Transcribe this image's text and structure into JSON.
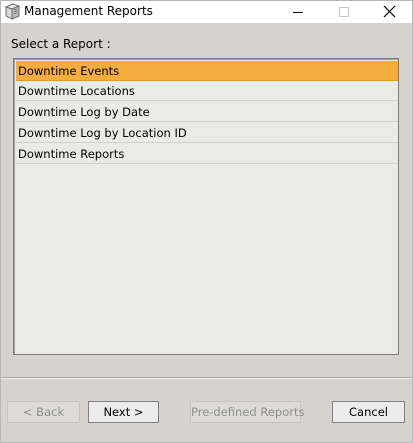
{
  "window": {
    "title": "Management Reports"
  },
  "prompt_label": "Select a Report :",
  "reports": [
    {
      "label": "Downtime Events",
      "selected": true
    },
    {
      "label": "Downtime Locations",
      "selected": false
    },
    {
      "label": "Downtime Log by Date",
      "selected": false
    },
    {
      "label": "Downtime Log by Location ID",
      "selected": false
    },
    {
      "label": "Downtime Reports",
      "selected": false
    }
  ],
  "buttons": {
    "back": "< Back",
    "next": "Next >",
    "predefined": "Pre-defined Reports",
    "cancel": "Cancel"
  },
  "colors": {
    "selection": "#f4ad3f",
    "list_background": "#ebebe6",
    "window_background": "#d6d3ce"
  },
  "icons": {
    "app": "report-book-icon",
    "minimize": "minimize-icon",
    "maximize": "maximize-icon",
    "close": "close-icon"
  }
}
